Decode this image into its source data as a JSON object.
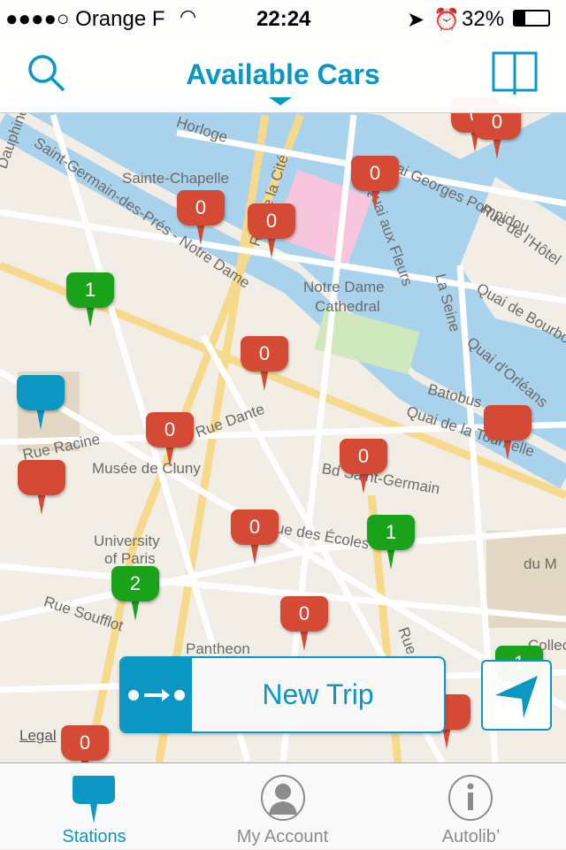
{
  "status_bar": {
    "carrier": "●●●●○ Orange F",
    "time": "22:24",
    "battery": "32%"
  },
  "nav": {
    "title": "Available Cars",
    "left_icon": "search-icon",
    "right_icon": "book-icon"
  },
  "colors": {
    "accent": "#0b97c4",
    "red_pin": "#d54a35",
    "green_pin": "#1aa31a",
    "blue_pin": "#0b97c4"
  },
  "map": {
    "labels": [
      "Horloge",
      "Saint-Germain-des-Prés - Notre Dame",
      "Sainte-Chapelle",
      "Rue de la Cité",
      "Notre Dame",
      "Cathedral",
      "Quai aux Fleurs",
      "La Seine",
      "Quai Georges Pompidou",
      "Rue de l'Hôtel",
      "Quai de Bourbon",
      "Quai d'Orléans",
      "Batobus",
      "Quai de la Tournelle",
      "Rue Dante",
      "Rue Racine",
      "Musée de Cluny",
      "Bd Saint-Germain",
      "University",
      "of Paris",
      "Rue des Écoles",
      "Rue Soufflot",
      "Pantheon",
      "Rue Monge",
      "Dauphine",
      "du M",
      "Collecti"
    ],
    "legal": "Legal",
    "pins": [
      {
        "count": "0",
        "color": "red"
      },
      {
        "count": "0",
        "color": "red"
      },
      {
        "count": "0",
        "color": "red"
      },
      {
        "count": "0",
        "color": "red"
      },
      {
        "count": "0",
        "color": "red"
      },
      {
        "count": "1",
        "color": "green"
      },
      {
        "count": "",
        "color": "blue"
      },
      {
        "count": "0",
        "color": "red"
      },
      {
        "count": "0",
        "color": "red"
      },
      {
        "count": "0",
        "color": "red"
      },
      {
        "count": "",
        "color": "red"
      },
      {
        "count": "",
        "color": "red"
      },
      {
        "count": "1",
        "color": "green"
      },
      {
        "count": "0",
        "color": "red"
      },
      {
        "count": "2",
        "color": "green"
      },
      {
        "count": "0",
        "color": "red"
      },
      {
        "count": "0",
        "color": "red"
      },
      {
        "count": "1",
        "color": "green"
      },
      {
        "count": "",
        "color": "red"
      }
    ]
  },
  "new_trip": {
    "label": "New Trip"
  },
  "tabs": [
    {
      "label": "Stations",
      "active": true
    },
    {
      "label": "My Account",
      "active": false
    },
    {
      "label": "Autolib’",
      "active": false
    }
  ]
}
